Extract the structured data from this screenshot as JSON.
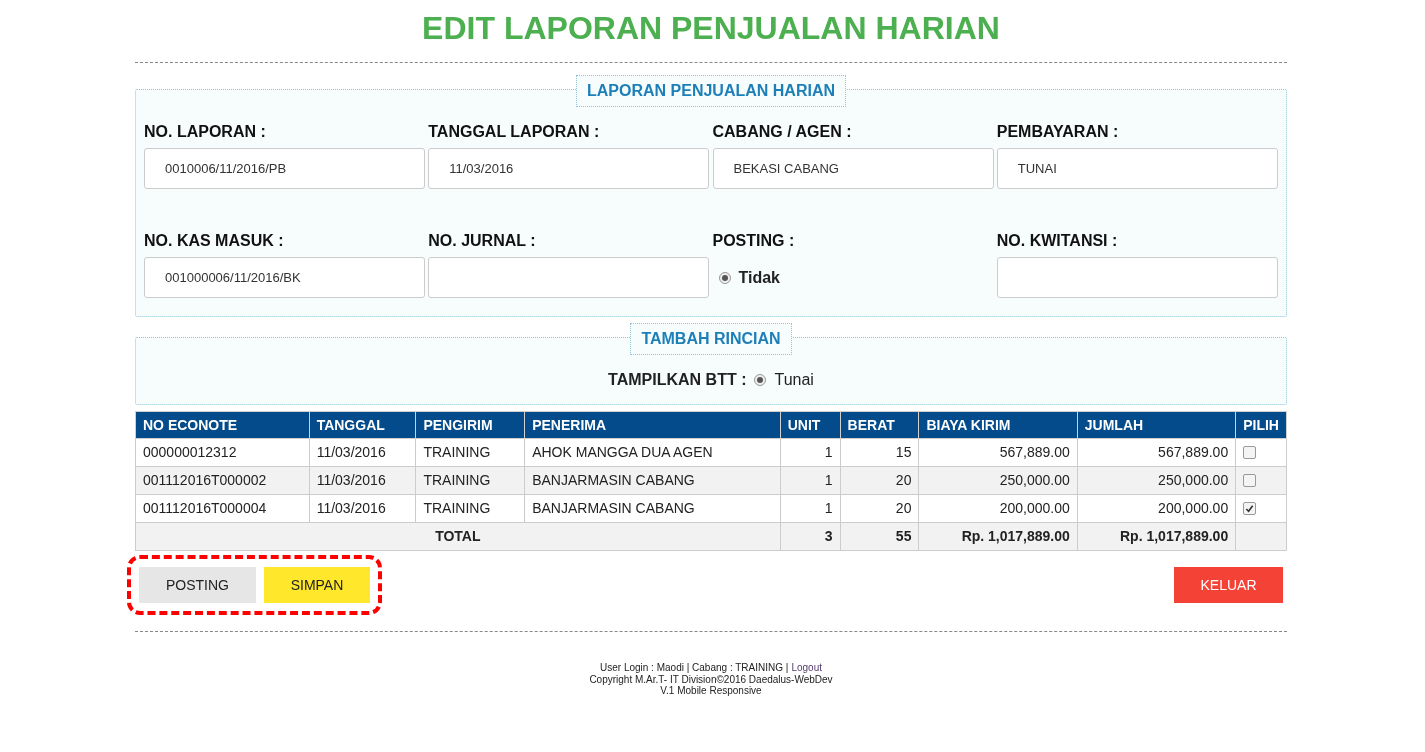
{
  "title": "EDIT LAPORAN PENJUALAN HARIAN",
  "report": {
    "legend": "LAPORAN PENJUALAN HARIAN",
    "fields": [
      {
        "label": "NO. LAPORAN :",
        "kind": "text",
        "value": "0010006/11/2016/PB"
      },
      {
        "label": "TANGGAL LAPORAN :",
        "kind": "text",
        "value": "11/03/2016"
      },
      {
        "label": "CABANG / AGEN :",
        "kind": "text",
        "value": "BEKASI CABANG"
      },
      {
        "label": "PEMBAYARAN :",
        "kind": "text",
        "value": "TUNAI"
      },
      {
        "label": "NO. KAS MASUK :",
        "kind": "text",
        "value": "001000006/11/2016/BK"
      },
      {
        "label": "NO. JURNAL :",
        "kind": "text"
      },
      {
        "label": "POSTING :",
        "kind": "radio",
        "options": [
          {
            "label": "Tidak",
            "selected": true
          }
        ]
      },
      {
        "label": "NO. KWITANSI :",
        "kind": "text"
      }
    ]
  },
  "details": {
    "legend": "TAMBAH RINCIAN",
    "label": "TAMPILKAN BTT :",
    "options": [
      {
        "label": "Tunai",
        "selected": true
      }
    ]
  },
  "table": {
    "columns": [
      "NO ECONOTE",
      "TANGGAL",
      "PENGIRIM",
      "PENERIMA",
      "UNIT",
      "BERAT",
      "BIAYA KIRIM",
      "JUMLAH",
      "PILIH"
    ],
    "rows": [
      {
        "cells": [
          "000000012312",
          "11/03/2016",
          "TRAINING",
          "AHOK MANGGA DUA AGEN",
          "1",
          "15",
          "567,889.00",
          "567,889.00"
        ],
        "checked": false
      },
      {
        "cells": [
          "001112016T000002",
          "11/03/2016",
          "TRAINING",
          "BANJARMASIN CABANG",
          "1",
          "20",
          "250,000.00",
          "250,000.00"
        ],
        "checked": false
      },
      {
        "cells": [
          "001112016T000004",
          "11/03/2016",
          "TRAINING",
          "BANJARMASIN CABANG",
          "1",
          "20",
          "200,000.00",
          "200,000.00"
        ],
        "checked": true
      }
    ],
    "total": {
      "label": "TOTAL",
      "values": [
        "3",
        "55",
        "Rp. 1,017,889.00",
        "Rp. 1,017,889.00"
      ]
    }
  },
  "buttons": [
    {
      "label": "POSTING",
      "kind": "posting"
    },
    {
      "label": "SIMPAN",
      "kind": "save"
    },
    {
      "label": "KELUAR",
      "kind": "exit"
    }
  ],
  "footer": {
    "login_text": "User Login : Maodi | Cabang : TRAINING |",
    "logout_link": "Logout",
    "lines": [
      "Copyright M.Ar.T- IT Division©2016 Daedalus-WebDev",
      "V.1 Mobile Responsive"
    ]
  }
}
